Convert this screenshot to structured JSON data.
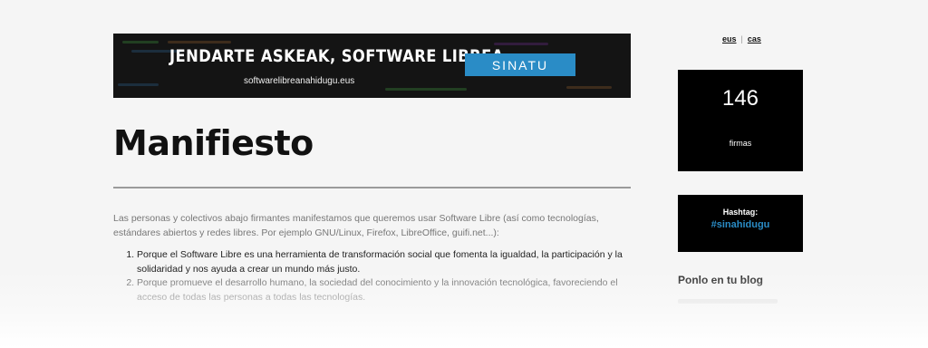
{
  "banner": {
    "title": "JENDARTE ASKEAK, SOFTWARE LIBREA",
    "url": "softwarelibreanahidugu.eus",
    "button_label": "SINATU",
    "button_color": "#2a8cc6"
  },
  "main": {
    "title": "Manifiesto",
    "intro": "Las personas y colectivos abajo firmantes manifestamos que queremos usar Software Libre (así como tecnologías, estándares abiertos y redes libres. Por ejemplo GNU/Linux, Firefox, LibreOffice, guifi.net...):",
    "points": [
      "Porque el Software Libre es una herramienta de transformación social que fomenta la igualdad, la participación y la solidaridad y nos ayuda a crear un mundo más justo.",
      "Porque promueve el desarrollo humano, la sociedad del conocimiento y la innovación tecnológica, favoreciendo el acceso de todas las personas a todas las tecnologías."
    ]
  },
  "sidebar": {
    "languages": [
      "eus",
      "cas"
    ],
    "signatures": {
      "count": "146",
      "label": "firmas"
    },
    "hashtag": {
      "label": "Hashtag:",
      "value": "#sinahidugu"
    },
    "blog_heading": "Ponlo en tu blog"
  },
  "colors": {
    "accent": "#2a8cc6",
    "box_background": "#000000",
    "page_background": "#f5f5f5"
  }
}
